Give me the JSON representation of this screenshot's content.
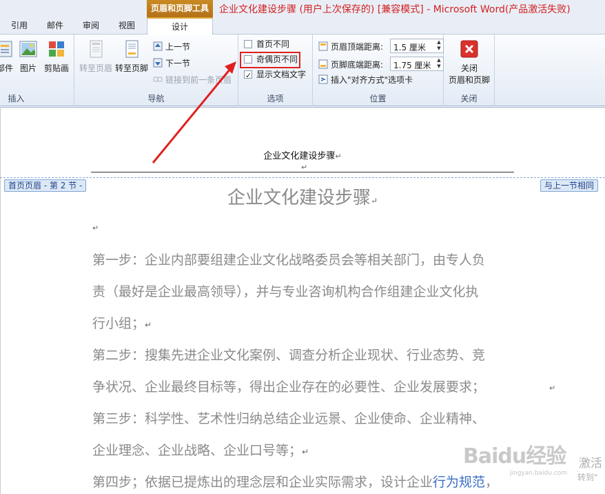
{
  "window": {
    "context_tab_group": "页眉和页脚工具",
    "title": "企业文化建设步骤 (用户上次保存的) [兼容模式] - Microsoft Word(产品激活失败)"
  },
  "tabs": [
    {
      "label": "引用"
    },
    {
      "label": "邮件"
    },
    {
      "label": "审阅"
    },
    {
      "label": "视图"
    },
    {
      "label": "设计"
    }
  ],
  "ribbon": {
    "insert_group": {
      "label": "插入",
      "buttons": [
        "部件",
        "图片",
        "剪贴画"
      ]
    },
    "navigation_group": {
      "label": "导航",
      "goto_header": "转至页眉",
      "goto_footer": "转至页脚",
      "prev_section": "上一节",
      "next_section": "下一节",
      "link_to_previous": "链接到前一条页眉"
    },
    "options_group": {
      "label": "选项",
      "different_first_page": {
        "label": "首页不同",
        "checked": false
      },
      "different_odd_even": {
        "label": "奇偶页不同",
        "checked": false
      },
      "show_document_text": {
        "label": "显示文档文字",
        "checked": true
      }
    },
    "position_group": {
      "label": "位置",
      "header_from_top": {
        "label": "页眉顶端距离:",
        "value": "1.5 厘米"
      },
      "footer_from_bottom": {
        "label": "页脚底端距离:",
        "value": "1.75 厘米"
      },
      "insert_alignment_tab": "插入\"对齐方式\"选项卡"
    },
    "close_group": {
      "label": "关闭",
      "close_button": "关闭\n页眉和页脚",
      "close_line1": "关闭",
      "close_line2": "页眉和页脚"
    }
  },
  "document": {
    "header_text": "企业文化建设步骤",
    "header_tag_left": "首页页眉 - 第 2 节 -",
    "header_tag_right": "与上一节相同",
    "title": "企业文化建设步骤",
    "paragraph_mark": "↵",
    "lines": [
      "第一步：企业内部要组建企业文化战略委员会等相关部门，由专人负",
      "责（最好是企业最高领导），并与专业咨询机构合作组建企业文化执",
      "行小组；",
      "第二步：搜集先进企业文化案例、调查分析企业现状、行业态势、竞",
      "争状况、企业最终目标等，得出企业存在的必要性、企业发展要求；",
      "第三步：科学性、艺术性归纳总结企业远景、企业使命、企业精神、",
      "企业理念、企业战略、企业口号等；",
      "第四步；依据已提炼出的理念层和企业实际需求，设计企业"
    ],
    "last_line_link": "行为规范",
    "last_line_tail": "，"
  },
  "watermark": {
    "brand": "Baidu经验",
    "sub": "jingyan.baidu.com",
    "activate_title": "激活",
    "activate_sub": "转到\""
  },
  "colors": {
    "accent_tab": "#e0a83a",
    "context_group": "#c98a22",
    "title_red": "#d21f1f",
    "highlight_box": "#e0201e",
    "arrow": "#e0201e",
    "body_text": "#8a8a8a"
  }
}
